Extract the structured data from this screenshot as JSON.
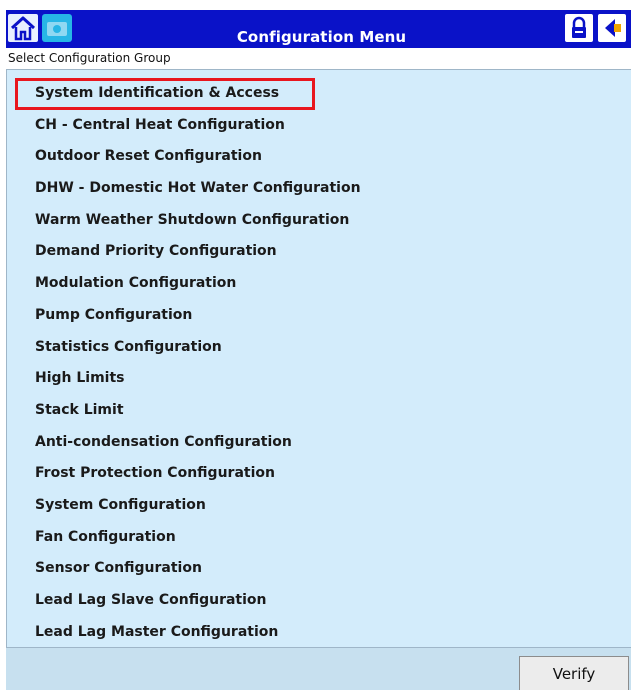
{
  "header": {
    "title": "Configuration Menu",
    "home_icon": "home-icon",
    "camera_icon": "camera-icon",
    "lock_icon": "lock-icon",
    "back_icon": "back-arrow-icon",
    "bar_color": "#0a12c8"
  },
  "subheader": {
    "label": "Select Configuration Group"
  },
  "list": {
    "items": [
      "System Identification & Access",
      "CH - Central Heat Configuration",
      "Outdoor Reset Configuration",
      "DHW - Domestic Hot Water Configuration",
      "Warm Weather Shutdown Configuration",
      "Demand Priority Configuration",
      "Modulation Configuration",
      "Pump Configuration",
      "Statistics Configuration",
      "High Limits",
      "Stack Limit",
      "Anti-condensation Configuration",
      "Frost Protection Configuration",
      "System Configuration",
      "Fan Configuration",
      "Sensor Configuration",
      "Lead Lag Slave Configuration",
      "Lead Lag Master Configuration"
    ],
    "selected_index": 0,
    "highlight_color": "#e8161e",
    "background_color": "#d3ecfb"
  },
  "footer": {
    "verify_label": "Verify"
  }
}
